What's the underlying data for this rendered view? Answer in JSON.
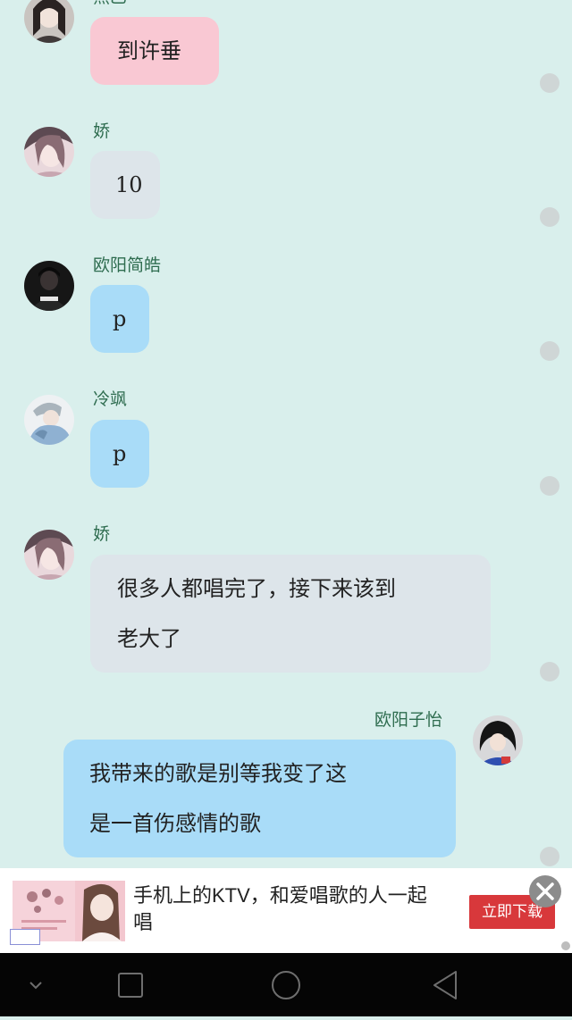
{
  "messages": [
    {
      "sender": "杰乙",
      "text_lines": [
        "到许垂"
      ],
      "bubble_color": "#f9c8d3",
      "side": "left"
    },
    {
      "sender": "娇",
      "text_lines": [
        "10"
      ],
      "bubble_color": "#dde5ea",
      "side": "left"
    },
    {
      "sender": "欧阳简皓",
      "text_lines": [
        "p"
      ],
      "bubble_color": "#a9dcf8",
      "side": "left"
    },
    {
      "sender": "冷飒",
      "text_lines": [
        "p"
      ],
      "bubble_color": "#a9dcf8",
      "side": "left"
    },
    {
      "sender": "娇",
      "text_lines": [
        "很多人都唱完了，接下来该到",
        "老大了"
      ],
      "bubble_color": "#dde5ea",
      "side": "left"
    },
    {
      "sender": "欧阳子怡",
      "text_lines": [
        "我带来的歌是别等我变了这",
        "是一首伤感情的歌"
      ],
      "bubble_color": "#a9dcf8",
      "side": "right"
    }
  ],
  "ad": {
    "title": "手机上的KTV，和爱唱歌的人一起唱",
    "cta": "立即下载",
    "close_icon": "close-icon",
    "cta_color": "#d8383b"
  },
  "navbar": {
    "icons": [
      "chevron-down-icon",
      "recents-icon",
      "home-icon",
      "back-icon"
    ]
  },
  "colors": {
    "background": "#d9efec",
    "sender_name": "#2e6c4f"
  }
}
